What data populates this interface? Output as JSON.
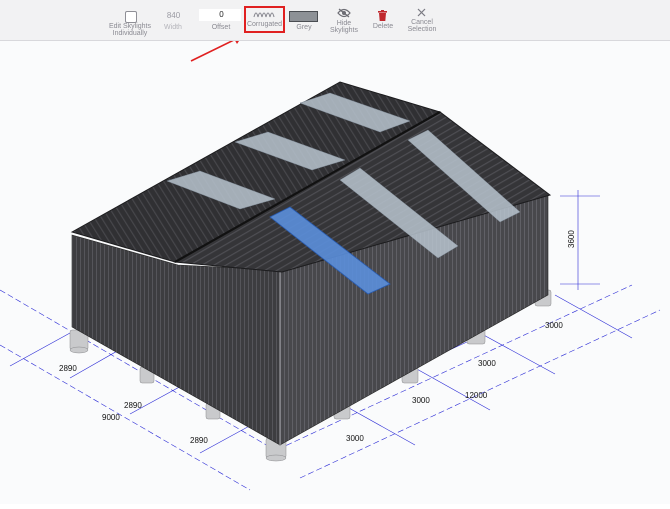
{
  "toolbar": {
    "edit_skylights": {
      "label_line1": "Edit Skylights",
      "label_line2": "Individually"
    },
    "width": {
      "value": "840",
      "label": "Width"
    },
    "offset": {
      "value": "0",
      "label": "Offset"
    },
    "profile": {
      "label": "Corrugated",
      "icon": "corrugated-wave-icon"
    },
    "colour": {
      "label": "Grey",
      "swatch": "#8d9196"
    },
    "hide_skylights": {
      "label_line1": "Hide",
      "label_line2": "Skylights",
      "icon": "eye-slash-icon"
    },
    "delete": {
      "label": "Delete",
      "icon": "trash-icon",
      "color": "#c0282d"
    },
    "cancel_selection": {
      "label_line1": "Cancel",
      "label_line2": "Selection",
      "icon": "close-icon"
    }
  },
  "highlight_color": "#e02020",
  "dimensions": {
    "height": "3600",
    "bay_spans_right": [
      "3000",
      "3000",
      "3000",
      "3000"
    ],
    "length_total": "12000",
    "bay_spans_left": [
      "2890",
      "2890",
      "2890"
    ],
    "width_total": "9000"
  },
  "colors": {
    "cladding": "#3a3a3c",
    "skylight": "#b9c4cf",
    "skylight_selected": "#5b8fdc",
    "dimension_line": "#2b2bd6"
  }
}
